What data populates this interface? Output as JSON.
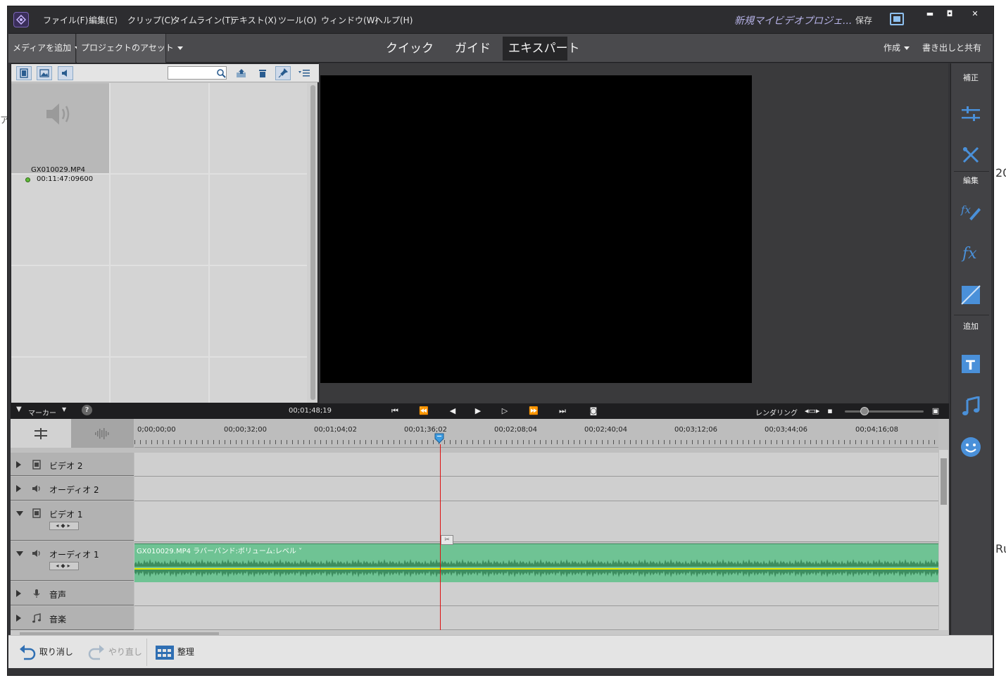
{
  "menu": {
    "items": [
      "ファイル(F)",
      "編集(E)",
      "クリップ(C)",
      "タイムライン(T)",
      "テキスト(X)",
      "ツール(O)",
      "ウィンドウ(W)",
      "ヘルプ(H)"
    ],
    "project_title": "新規マイビデオプロジェ...",
    "save": "保存"
  },
  "toolbar": {
    "add_media": "メディアを追加",
    "project_assets": "プロジェクトのアセット",
    "tabs": [
      "クイック",
      "ガイド",
      "エキスパート"
    ],
    "active_tab": "エキスパート",
    "create": "作成",
    "export_share": "書き出しと共有"
  },
  "media": {
    "clip_name": "GX010029.MP4",
    "clip_duration": "00:11:47:09600"
  },
  "transport": {
    "marker": "マーカー",
    "timecode": "00;01;48;19",
    "rendering": "レンダリング"
  },
  "ruler": {
    "ticks": [
      "0;00;00;00",
      "00;00;32;00",
      "00;01;04;02",
      "00;01;36;02",
      "00;02;08;04",
      "00;02;40;04",
      "00;03;12;06",
      "00;03;44;06",
      "00;04;16;08"
    ]
  },
  "tracks": [
    "ビデオ 2",
    "オーディオ 2",
    "ビデオ 1",
    "オーディオ 1",
    "音声",
    "音楽"
  ],
  "audio_clip_label": "GX010029.MP4 ラバーバンド:ボリューム:レベル ˅",
  "right_panel": {
    "correct": "補正",
    "edit": "編集",
    "add": "追加"
  },
  "bottom": {
    "undo": "取り消し",
    "redo": "やり直し",
    "organize": "整理"
  },
  "colors": {
    "accent": "#7a64b5",
    "audio_clip": "#6fc394",
    "playhead": "#d11111"
  }
}
